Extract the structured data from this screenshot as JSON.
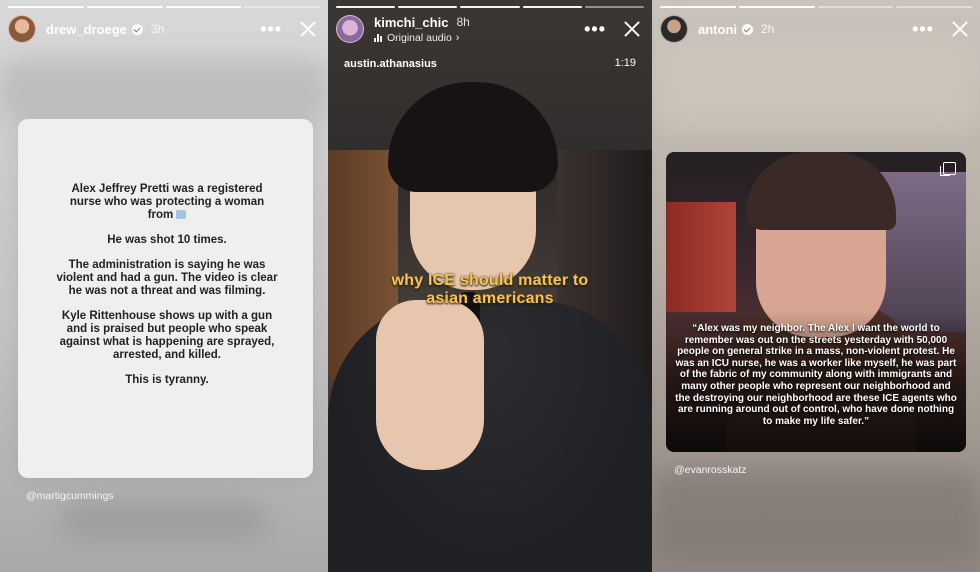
{
  "stories": [
    {
      "username": "drew_droege",
      "time": "3h",
      "card": {
        "paragraphs": [
          "Alex Jeffrey Pretti was a registered nurse who was protecting a woman from",
          "He was shot 10 times.",
          "The administration is saying he was violent and had a gun. The video is clear he was not a threat and was filming.",
          "Kyle Rittenhouse shows up with a gun and is praised but people who speak against what is happening are sprayed, arrested, and killed.",
          "This is tyranny."
        ]
      },
      "mention": "@martigcummings"
    },
    {
      "username": "kimchi_chic",
      "time": "8h",
      "audio_label": "Original audio",
      "reel_user": "austin.athanasius",
      "reel_time": "1:19",
      "caption_line1": "why ICE should matter to",
      "caption_line2": "asian americans"
    },
    {
      "username": "antoni",
      "time": "2h",
      "quote": "“Alex was my neighbor. The Alex I want the world to remember was out on the streets yesterday with 50,000 people on general strike in a mass, non-violent protest. He was an ICU nurse, he was a worker like myself, he was part of the fabric of my community along with immigrants and many other people who represent our neighborhood and the destroying our neighborhood are these ICE agents who are running around out of control, who have done nothing to make my life safer.”",
      "mention": "@evanrosskatz"
    }
  ],
  "icons": {
    "more": "more-options-icon",
    "close": "close-icon",
    "verified": "verified-badge-icon"
  },
  "colors": {
    "caption": "#f1c35a"
  }
}
